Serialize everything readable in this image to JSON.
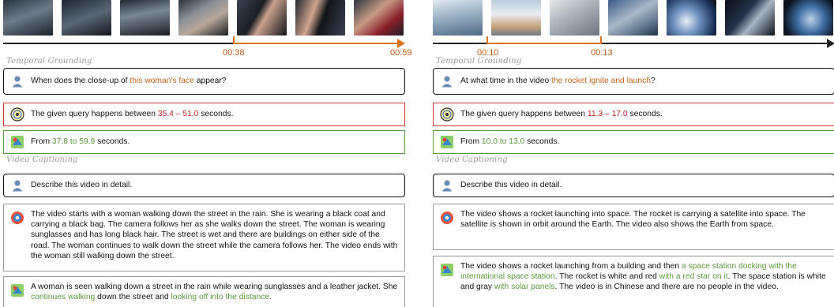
{
  "left": {
    "frames": [
      "street-rain-frame-1",
      "street-rain-frame-2",
      "street-rain-frame-3",
      "street-rain-frame-4",
      "woman-closeup-frame-1",
      "woman-closeup-frame-2",
      "woman-closeup-frame-3"
    ],
    "timeline": {
      "marker_start": "00:38",
      "marker_end": "00:59"
    },
    "sections": {
      "grounding": "Temporal Grounding",
      "captioning": "Video Captioning"
    },
    "grounding": {
      "question_pre": "When does the close-up of ",
      "question_hl": "this woman's face",
      "question_post": " appear?",
      "answer1_pre": "The given query happens between ",
      "answer1_hl": "35.4 – 51.0",
      "answer1_post": " seconds.",
      "answer2_pre": "From ",
      "answer2_hl": "37.8 to 59.9",
      "answer2_post": " seconds."
    },
    "captioning": {
      "question": "Describe this video in detail.",
      "answer1": "The video starts with a woman walking down the street in the rain. She is wearing a black coat and carrying a black bag. The camera follows her as she walks down the street. The woman is wearing sunglasses and has long black hair. The street is wet and there are buildings on either side of the road. The woman continues to walk down the street while the camera follows her. The video ends with the woman still walking down the street.",
      "answer2_a": "A woman is seen walking down a street in the rain while wearing sunglasses and a leather jacket. She ",
      "answer2_hl1": "continues walking",
      "answer2_b": " down the street and ",
      "answer2_hl2": "looking off into the distance",
      "answer2_c": "."
    }
  },
  "right": {
    "frames": [
      "building-frame",
      "rocket-launch-frame",
      "space-station-frame",
      "station-orbit-frame",
      "earth-frame",
      "satellite-frame",
      "earth-window-frame"
    ],
    "timeline": {
      "marker_start": "00:10",
      "marker_end": "00:13"
    },
    "sections": {
      "grounding": "Temporal Grounding",
      "captioning": "Video Captioning"
    },
    "grounding": {
      "question_pre": "At what time in the video ",
      "question_hl": "the rocket ignite and launch",
      "question_post": "?",
      "answer1_pre": "The given query happens between ",
      "answer1_hl": "11.3 – 17.0",
      "answer1_post": " seconds.",
      "answer2_pre": "From ",
      "answer2_hl": "10.0 to 13.0",
      "answer2_post": " seconds."
    },
    "captioning": {
      "question": "Describe this video in detail.",
      "answer1": "The video shows a rocket launching into space. The rocket is carrying a satellite into space. The satellite is shown in orbit around the Earth. The video also shows the Earth from space.",
      "answer2_a": "The video shows a rocket launching from a building and then ",
      "answer2_hl1": "a space station docking with the international space station",
      "answer2_b": ". The rocket is white and red ",
      "answer2_hl2": "with a red star on it",
      "answer2_c": ". The space station is white and gray ",
      "answer2_hl3": "with solar panels",
      "answer2_d": ". The video is in Chinese and there are no people in the video."
    }
  }
}
